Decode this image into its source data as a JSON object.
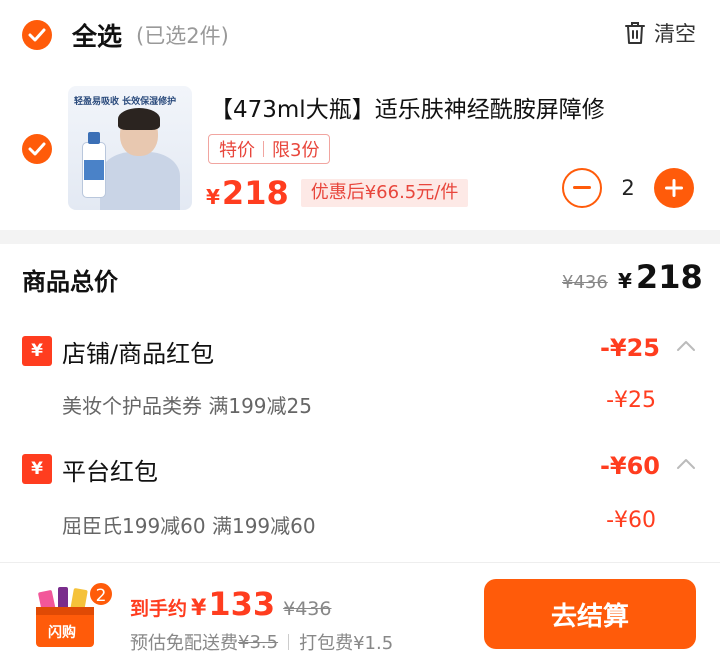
{
  "header": {
    "title": "全选",
    "count": "(已选2件)",
    "clear_label": "清空"
  },
  "product": {
    "name": "【473ml大瓶】适乐肤神经酰胺屏障修",
    "thumb_text": "轻盈易吸收 长效保湿修护",
    "tag_special": "特价",
    "tag_limit": "限3份",
    "price_symbol": "¥",
    "price": "218",
    "discount_text": "优惠后¥66.5元/件",
    "quantity": "2"
  },
  "summary": {
    "total_label": "商品总价",
    "total_original": "¥436",
    "total_symbol": "¥",
    "total_final": "218"
  },
  "coupons": [
    {
      "badge": "¥",
      "name": "店铺/商品红包",
      "amount": "-¥25",
      "detail": "美妆个护品类券 满199减25",
      "detail_amount": "-¥25"
    },
    {
      "badge": "¥",
      "name": "平台红包",
      "amount": "-¥60",
      "detail": "屈臣氏199减60 满199减60",
      "detail_amount": "-¥60"
    }
  ],
  "bottom": {
    "cart_count": "2",
    "cart_icon_text": "闪购",
    "estimate_label": "到手约",
    "estimate_symbol": "¥",
    "estimate_value": "133",
    "estimate_original": "¥436",
    "shipping_label": "预估免配送费",
    "shipping_original": "¥3.5",
    "packing_fee": "打包费¥1.5",
    "checkout_label": "去结算"
  },
  "colors": {
    "accent": "#ff5b0a",
    "price_red": "#ff3d1f",
    "divider": "#f3f3f3"
  }
}
